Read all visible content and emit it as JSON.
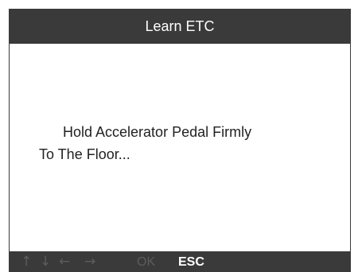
{
  "screen": {
    "title": "Learn ETC"
  },
  "message": {
    "line1": "Hold Accelerator Pedal Firmly",
    "line2": "To The Floor..."
  },
  "bottom_bar": {
    "keys": {
      "up_icon": "arrow-up-icon",
      "down_icon": "arrow-down-icon",
      "left_icon": "arrow-left-icon",
      "right_icon": "arrow-right-icon",
      "ok_label": "OK",
      "esc_label": "ESC"
    },
    "states": {
      "arrows_enabled": false,
      "ok_enabled": false,
      "esc_enabled": true
    }
  },
  "colors": {
    "frame": "#3a3a3a",
    "content_bg": "#ffffff",
    "text": "#222222",
    "disabled_key": "#5c5c5c",
    "active_key": "#ffffff"
  }
}
